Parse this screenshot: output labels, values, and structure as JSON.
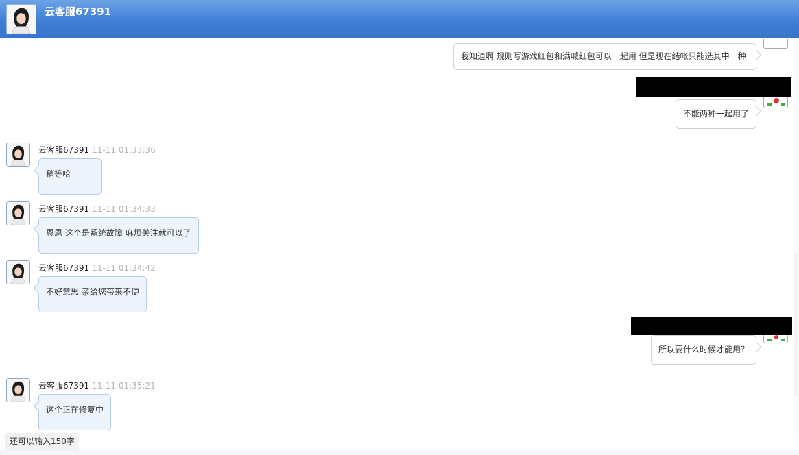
{
  "header": {
    "title": "云客服67391"
  },
  "messages": [
    {
      "side": "right",
      "text": "我知道啊  规则写游戏红包和满喊红包可以一起用 但是现在结帐只能选其中一种"
    },
    {
      "side": "right",
      "text": "不能两种一起用了"
    },
    {
      "side": "left",
      "name": "云客服67391",
      "time": "11-11 01:33:36",
      "text": "稍等哈"
    },
    {
      "side": "left",
      "name": "云客服67391",
      "time": "11-11 01:34:33",
      "text": "恩恩 这个是系统故障 麻烦关注就可以了"
    },
    {
      "side": "left",
      "name": "云客服67391",
      "time": "11-11 01:34:42",
      "text": "不好意思 亲给您带来不便"
    },
    {
      "side": "right",
      "text": "所以要什么时候才能用？"
    },
    {
      "side": "left",
      "name": "云客服67391",
      "time": "11-11 01:35:21",
      "text": "这个正在修复中"
    }
  ],
  "footer": {
    "counter": "还可以输入150字"
  }
}
